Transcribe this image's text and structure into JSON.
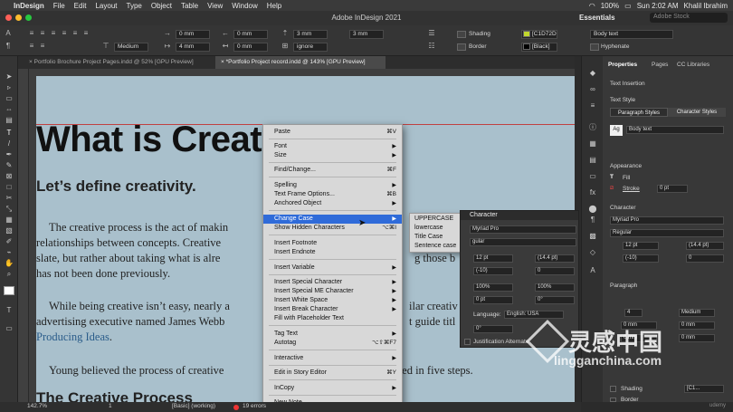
{
  "menubar": {
    "apple": "",
    "app": "InDesign",
    "items": [
      "File",
      "Edit",
      "Layout",
      "Type",
      "Object",
      "Table",
      "View",
      "Window",
      "Help"
    ],
    "battery": "100%",
    "clock": "Sun 2:02 AM",
    "user": "Khalil Ibrahim"
  },
  "titlebar": {
    "title": "Adobe InDesign 2021",
    "workspace": "Essentials",
    "search_placeholder": "Adobe Stock"
  },
  "controlbar": {
    "font_weight": "Medium",
    "indent_left": "0 mm",
    "indent_right": "0 mm",
    "indent_first": "0 mm",
    "space_before": "0 mm",
    "space_after": "4 mm",
    "space_after2": "0 mm",
    "drop_cap_lines": "3 mm",
    "drop_cap_chars": "3 mm",
    "grid_align": "ignore",
    "shading_label": "Shading",
    "border_label": "Border",
    "shading_color": "[C1D72D",
    "border_color": "[Black]",
    "paragraph_style": "Body text",
    "hyphenate_label": "Hyphenate",
    "shading_hex": "#c1d72d"
  },
  "tabs": [
    {
      "label": "Portfolio Brochure Project Pages.indd @ 52% [GPU Preview]"
    },
    {
      "label": "*Portfolio Project record.indd @ 143% [GPU Preview]"
    }
  ],
  "document": {
    "heading": "What is Creat",
    "subheading": "Let’s define creativity.",
    "para1_line1": "The creative process is the act of makin",
    "para1_line1_end": "",
    "para1_line2": "relationships between concepts. Creative",
    "para1_line3": "slate, but rather about taking what is alre",
    "para1_line3_end": "g those b",
    "para1_line4": "has not been done previously.",
    "para2_line1": "While being creative isn’t easy, nearly a",
    "para2_line1_end": "ilar creativ",
    "para2_line2": "advertising executive named James Webb",
    "para2_line2_end": "t guide titl",
    "para2_line3_link": "Producing Ideas",
    "para2_line3_end": ".",
    "para3_line1": "Young believed the process of creative",
    "para3_line1_end": "red in five steps.",
    "heading2": "The Creative Process"
  },
  "context_menu": {
    "items": [
      {
        "label": "Paste",
        "shortcut": "⌘V"
      },
      {
        "label": "Font",
        "submenu": true
      },
      {
        "label": "Size",
        "submenu": true
      },
      {
        "label": "Find/Change...",
        "shortcut": "⌘F"
      },
      {
        "label": "Spelling",
        "submenu": true
      },
      {
        "label": "Text Frame Options...",
        "shortcut": "⌘B"
      },
      {
        "label": "Anchored Object",
        "submenu": true
      },
      {
        "label": "Change Case",
        "submenu": true,
        "highlighted": true
      },
      {
        "label": "Show Hidden Characters",
        "shortcut": "⌥⌘I"
      },
      {
        "label": "Insert Footnote"
      },
      {
        "label": "Insert Endnote"
      },
      {
        "label": "Insert Variable",
        "submenu": true
      },
      {
        "label": "Insert Special Character",
        "submenu": true
      },
      {
        "label": "Insert Special ME Character",
        "submenu": true
      },
      {
        "label": "Insert White Space",
        "submenu": true
      },
      {
        "label": "Insert Break Character",
        "submenu": true
      },
      {
        "label": "Fill with Placeholder Text"
      },
      {
        "label": "Tag Text",
        "submenu": true
      },
      {
        "label": "Autotag",
        "shortcut": "⌥⇧⌘F7"
      },
      {
        "label": "Interactive",
        "submenu": true
      },
      {
        "label": "Edit in Story Editor",
        "shortcut": "⌘Y"
      },
      {
        "label": "InCopy",
        "submenu": true
      },
      {
        "label": "New Note"
      }
    ],
    "submenu_arrow": "▶"
  },
  "change_case_submenu": {
    "items": [
      "UPPERCASE",
      "lowercase",
      "Title Case",
      "Sentence case"
    ]
  },
  "character_panel": {
    "title": "Character",
    "font": "Myriad Pro",
    "style": "gular",
    "size": "12 pt",
    "leading": "(14.4 pt)",
    "kerning": "(-10)",
    "tracking": "0",
    "vscale": "100%",
    "hscale": "100%",
    "baseline": "0 pt",
    "skew": "0°",
    "language_label": "Language:",
    "language": "English: USA",
    "rotation": "0°",
    "justification": "Justification Alternate"
  },
  "properties_panel": {
    "tab_properties": "Properties",
    "tab_pages": "Pages",
    "tab_cc": "CC Libraries",
    "text_insertion": "Text Insertion",
    "text_style": "Text Style",
    "paragraph_styles": "Paragraph Styles",
    "character_styles": "Character Styles",
    "style_value": "Body text",
    "appearance": "Appearance",
    "fill": "Fill",
    "stroke": "Stroke",
    "stroke_value": "0 pt",
    "character": "Character",
    "font": "Myriad Pro",
    "style": "Regular",
    "size": "12 pt",
    "leading": "(14.4 pt)",
    "kerning": "(-10)",
    "tracking": "0",
    "paragraph": "Paragraph",
    "para_weight": "Medium",
    "para_indent": "4",
    "zero1": "0 mm",
    "zero2": "0 mm",
    "zero3": "0 mm",
    "zero4": "0 mm",
    "shading": "Shading",
    "shading_color": "[C1...",
    "border": "Border",
    "border_color": "[Bl..."
  },
  "statusbar": {
    "zoom": "142.7%",
    "page": "1",
    "style": "[Basic] (working)",
    "errors": "19 errors"
  },
  "watermark": {
    "text_cn": "灵感中国",
    "url": "lingganchina.com",
    "corner": "udemy"
  }
}
